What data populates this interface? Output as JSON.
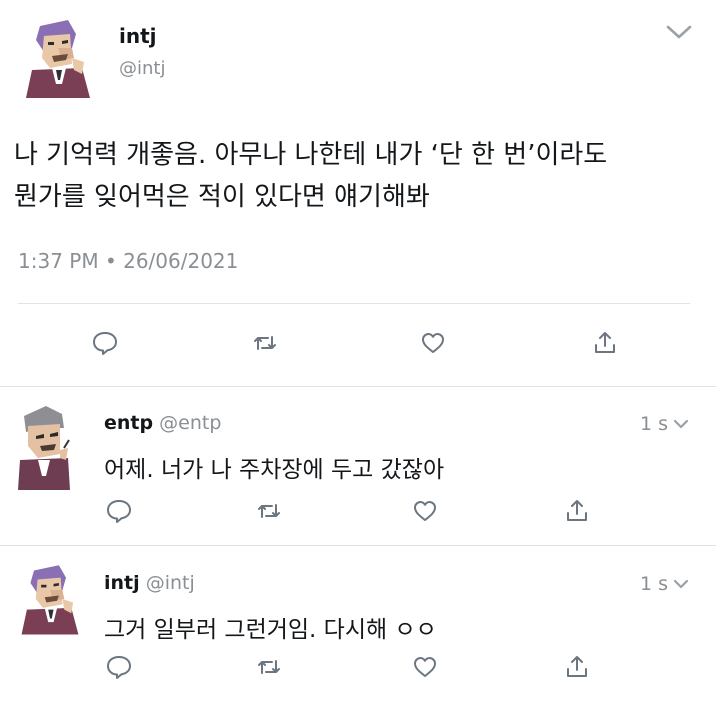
{
  "main_tweet": {
    "display_name": "intj",
    "handle": "@intj",
    "text_line1": "나 기억력 개좋음. 아무나 나한테 내가 ‘단 한 번’이라도",
    "text_line2": "뭔가를 잊어먹은 적이 있다면 얘기해봐",
    "timestamp": "1:37 PM • 26/06/2021",
    "avatar_icon": "purple-haired-man-avatar-icon",
    "menu_icon": "chevron-down-icon"
  },
  "replies": [
    {
      "display_name": "entp",
      "handle": "@entp",
      "time": "1 s",
      "text": "어제. 너가 나 주차장에 두고 갔잖아",
      "avatar_icon": "gray-haired-man-avatar-icon"
    },
    {
      "display_name": "intj",
      "handle": "@intj",
      "time": "1 s",
      "text": "그거 일부러 그런거임. 다시해 ㅇㅇ",
      "avatar_icon": "purple-haired-man-avatar-icon"
    }
  ],
  "action_icons": [
    "reply-icon",
    "retweet-icon",
    "like-icon",
    "share-icon"
  ],
  "colors": {
    "text": "#14171a",
    "secondary": "#8a8f94",
    "divider": "#e1e4e6",
    "icon": "#6b7680"
  }
}
